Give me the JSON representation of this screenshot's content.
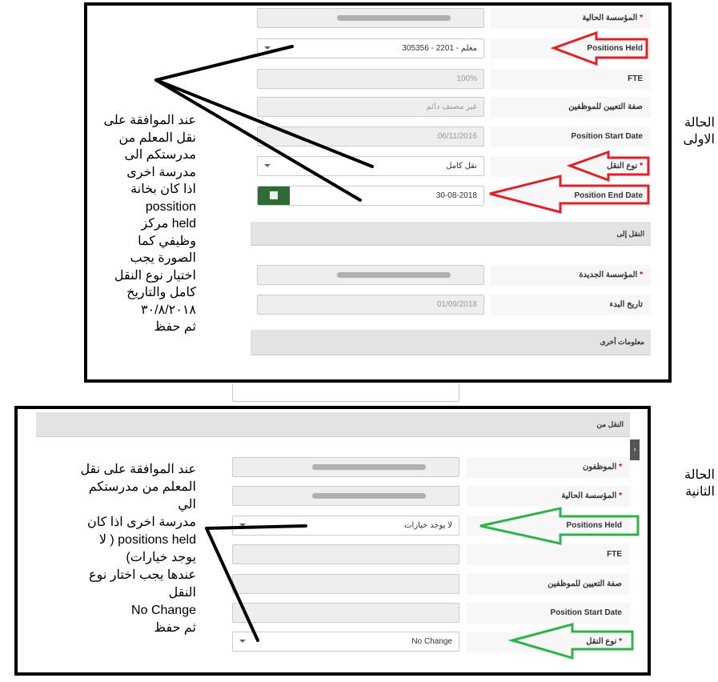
{
  "case1": {
    "title": "الحالة الاولى",
    "rows": [
      {
        "label": "المؤسسة الحالية",
        "required": true,
        "value": ""
      },
      {
        "label": "Positions Held",
        "value": "معلم - 2201 - 305356"
      },
      {
        "label": "FTE",
        "value": "100%"
      },
      {
        "label": "صفة التعيين للموظفين",
        "value": "غير مصنف دائم"
      },
      {
        "label": "Position Start Date",
        "value": "06/11/2016"
      },
      {
        "label": "نوع النقل",
        "required": true,
        "value": "نقل كامل"
      },
      {
        "label": "Position End Date",
        "value": "30-08-2018"
      }
    ],
    "section_to": "النقل إلى",
    "to_rows": [
      {
        "label": "المؤسسة الجديدة",
        "required": true,
        "value": ""
      },
      {
        "label": "تاريخ البدء",
        "value": "01/09/2018"
      }
    ],
    "section_other": "معلومات أخرى",
    "note": [
      "عند الموافقة على",
      "نقل المعلم من",
      "مدرستكم الى",
      "مدرسة اخرى",
      "اذا كان بخانة",
      "possition",
      "held  مركز",
      "وظيفي كما",
      "الصورة يجب",
      "اختيار نوع النقل",
      "كامل والتاريخ",
      "٣٠/٨/٢٠١٨",
      "ثم حفظ"
    ]
  },
  "case2": {
    "title": "الحالة الثانية",
    "section_from": "النقل من",
    "rows": [
      {
        "label": "الموظفون",
        "required": true,
        "value": ""
      },
      {
        "label": "المؤسسة الحالية",
        "required": true,
        "value": ""
      },
      {
        "label": "Positions Held",
        "value": "لا يوجد خيارات"
      },
      {
        "label": "FTE",
        "value": ""
      },
      {
        "label": "صفة التعيين للموظفين",
        "value": ""
      },
      {
        "label": "Position Start Date",
        "value": ""
      },
      {
        "label": "نوع النقل",
        "required": true,
        "value": "No Change"
      }
    ],
    "note": [
      "عند الموافقة على نقل",
      "المعلم من مدرستكم الي",
      "مدرسة اخرى اذا كان",
      "positions held  ( لا",
      "يوجد خيارات)",
      "عندها يجب اختار نوع",
      "النقل",
      "No Change",
      "ثم حفظ"
    ]
  },
  "colors": {
    "red_arrow": "#e0202a",
    "green_arrow": "#2db34a",
    "calendar_button": "#2e6b35"
  },
  "icons": {
    "calendar": "calendar-icon",
    "dropdown": "caret-down-icon",
    "side_tab": "chevron-right-icon"
  }
}
